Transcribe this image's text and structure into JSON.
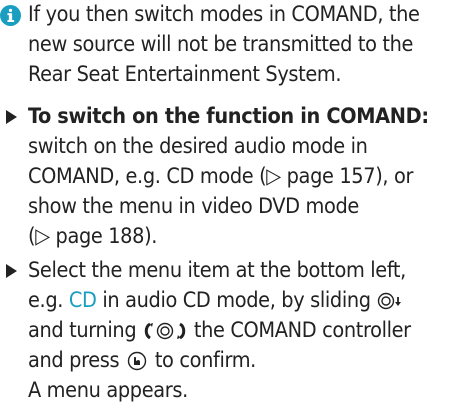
{
  "accent_color": "#1a9ec0",
  "note": {
    "icon": "info-icon",
    "line1": "If you then switch modes in COMAND, the",
    "line2": "new source will not be transmitted to the",
    "line3": "Rear Seat Entertainment System."
  },
  "step1": {
    "bullet": "arrow-right-icon",
    "heading": "To switch on the function in COMAND:",
    "line2": "switch on the desired audio mode in",
    "line3": "COMAND, e.g. CD mode (▷ page 157), or",
    "line4": "show the menu in video DVD mode",
    "line5": "(▷ page 188)."
  },
  "step2": {
    "bullet": "arrow-right-icon",
    "line1": "Select the menu item at the bottom left,",
    "line2_pre": "e.g.",
    "line2_menu_item": "CD",
    "line2_post": "in audio CD mode, by sliding",
    "line3_pre": "and turning",
    "line3_post": "the COMAND controller",
    "line4_pre": "and press",
    "line4_post": "to confirm.",
    "result": "A menu appears.",
    "icons": [
      "controller-slide-down-icon",
      "controller-turn-icon",
      "controller-press-icon"
    ]
  }
}
